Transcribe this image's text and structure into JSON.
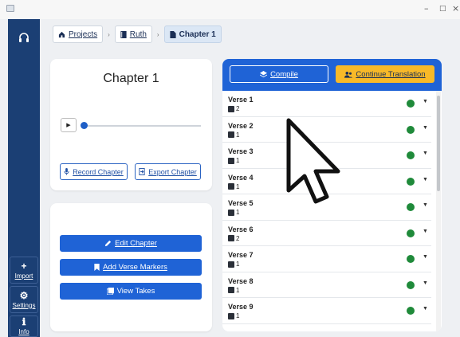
{
  "window": {
    "controls": {
      "minimize": "–",
      "maximize": "□",
      "close": "×"
    }
  },
  "sidebar": {
    "top_icon": "headphones-icon",
    "buttons": [
      {
        "glyph": "+",
        "label": "Import",
        "icon": "plus-icon"
      },
      {
        "glyph": "⚙",
        "label": "Settings",
        "icon": "gear-icon"
      },
      {
        "glyph": "ℹ",
        "label": "Info",
        "icon": "info-icon"
      }
    ]
  },
  "breadcrumb": {
    "items": [
      {
        "label": "Projects",
        "icon": "home-icon"
      },
      {
        "label": "Ruth",
        "icon": "book-icon"
      },
      {
        "label": "Chapter 1",
        "icon": "document-icon"
      }
    ],
    "separator": "›"
  },
  "chapter_card": {
    "title": "Chapter 1",
    "play_glyph": "▶",
    "playback_progress": 0,
    "record_label": "Record Chapter",
    "export_label": "Export Chapter"
  },
  "actions_card": {
    "edit_label": "Edit Chapter",
    "markers_label": "Add Verse Markers",
    "view_label": "View Takes"
  },
  "verse_panel": {
    "compile_label": "Compile",
    "continue_label": "Continue Translation",
    "status_color": "#1f8a3a",
    "verses": [
      {
        "label": "Verse 1",
        "takes": "2"
      },
      {
        "label": "Verse 2",
        "takes": "1"
      },
      {
        "label": "Verse 3",
        "takes": "1"
      },
      {
        "label": "Verse 4",
        "takes": "1"
      },
      {
        "label": "Verse 5",
        "takes": "1"
      },
      {
        "label": "Verse 6",
        "takes": "2"
      },
      {
        "label": "Verse 7",
        "takes": "1"
      },
      {
        "label": "Verse 8",
        "takes": "1"
      },
      {
        "label": "Verse 9",
        "takes": "1"
      }
    ]
  },
  "colors": {
    "sidebar": "#1b3f74",
    "primary": "#1f63d6",
    "accent": "#f7b928",
    "status_ok": "#1f8a3a"
  }
}
